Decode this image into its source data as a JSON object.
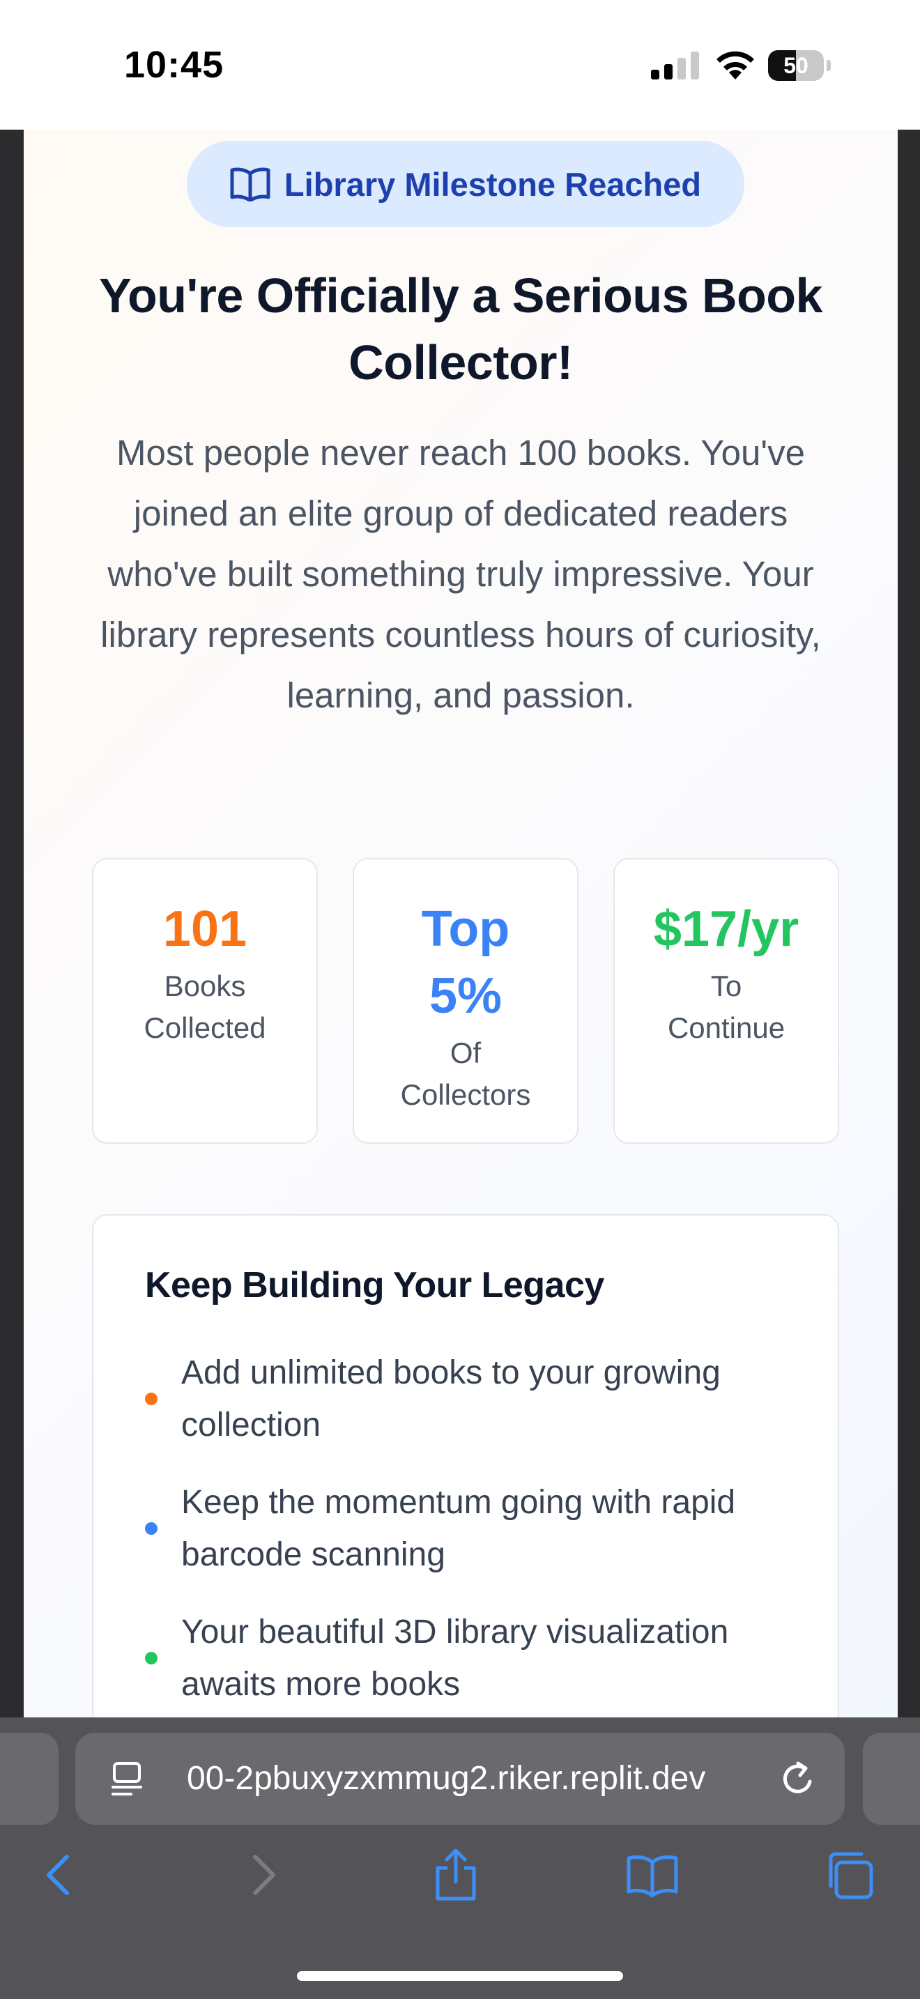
{
  "status_bar": {
    "time": "10:45",
    "battery_percent": "50",
    "battery_level": 0.5,
    "icons": [
      "cellular-signal-icon",
      "wifi-icon",
      "battery-icon"
    ]
  },
  "page": {
    "badge": {
      "icon": "open-book-icon",
      "label": "Library Milestone Reached",
      "color": "#1e40af",
      "background": "#dbeafe"
    },
    "title": "You're Officially a Serious Book Collector!",
    "description": "Most people never reach 100 books. You've joined an elite group of dedicated readers who've built something truly impressive. Your library represents countless hours of curiosity, learning, and passion.",
    "stats": [
      {
        "value": "101",
        "label": "Books Collected",
        "color": "#f97316"
      },
      {
        "value": "Top 5%",
        "label": "Of Collectors",
        "color": "#3b82f6"
      },
      {
        "value": "$17/yr",
        "label": "To Continue",
        "color": "#22c55e"
      }
    ],
    "legacy": {
      "title": "Keep Building Your Legacy",
      "items": [
        {
          "text": "Add unlimited books to your growing collection",
          "dot_color": "#f97316"
        },
        {
          "text": "Keep the momentum going with rapid barcode scanning",
          "dot_color": "#3b82f6"
        },
        {
          "text": "Your beautiful 3D library visualization awaits more books",
          "dot_color": "#22c55e"
        }
      ]
    }
  },
  "browser": {
    "url": "00-2pbuxyzxmmug2.riker.replit.dev",
    "url_icons": [
      "page-settings-icon",
      "reload-icon"
    ],
    "toolbar": [
      "back-icon",
      "forward-icon",
      "share-icon",
      "bookmarks-icon",
      "tabs-icon"
    ],
    "accent": "#3b8ff6"
  }
}
